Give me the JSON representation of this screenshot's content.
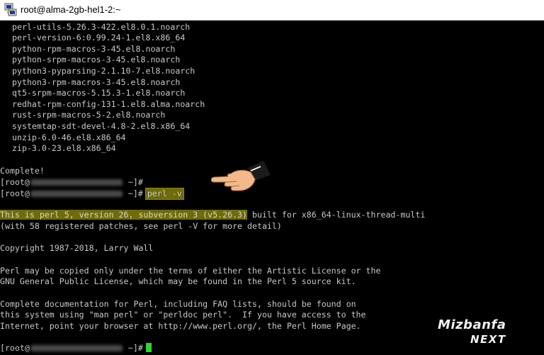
{
  "window": {
    "title": "root@alma-2gb-hel1-2:~",
    "icon": "putty-icon"
  },
  "terminal": {
    "packages": [
      "perl-utils-5.26.3-422.el8.0.1.noarch",
      "perl-version-6:0.99.24-1.el8.x86_64",
      "python-rpm-macros-3-45.el8.noarch",
      "python-srpm-macros-3-45.el8.noarch",
      "python3-pyparsing-2.1.10-7.el8.noarch",
      "python3-rpm-macros-3-45.el8.noarch",
      "qt5-srpm-macros-5.15.3-1.el8.noarch",
      "redhat-rpm-config-131-1.el8.alma.noarch",
      "rust-srpm-macros-5-2.el8.noarch",
      "systemtap-sdt-devel-4.8-2.el8.x86_64",
      "unzip-6.0-46.el8.x86_64",
      "zip-3.0-23.el8.x86_64"
    ],
    "complete": "Complete!",
    "prompt_open": "[root@",
    "prompt_close": " ~]#",
    "command": "perl -v",
    "version_highlight": "This is perl 5, version 26, subversion 3 (v5.26.3)",
    "version_rest": " built for x86_64-linux-thread-multi",
    "patches": "(with 58 registered patches, see perl -V for more detail)",
    "copyright": "Copyright 1987-2018, Larry Wall",
    "license": [
      "Perl may be copied only under the terms of either the Artistic License or the",
      "GNU General Public License, which may be found in the Perl 5 source kit."
    ],
    "docs": [
      "Complete documentation for Perl, including FAQ lists, should be found on",
      "this system using \"man perl\" or \"perldoc perl\".  If you have access to the",
      "Internet, point your browser at http://www.perl.org/, the Perl Home Page."
    ]
  },
  "watermark": {
    "line1": "Mizbanfa",
    "line2": "NEXT"
  },
  "colors": {
    "highlight": "#6e6b0a",
    "cursor": "#2ed52e",
    "text": "#c8c8c8"
  }
}
